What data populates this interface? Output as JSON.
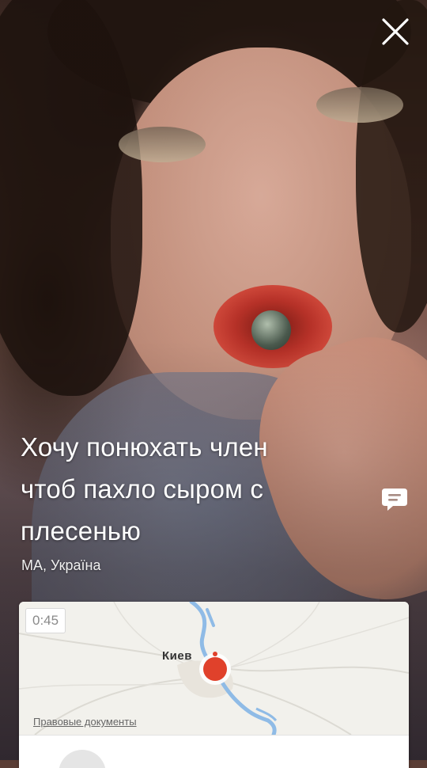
{
  "post": {
    "text_lines": [
      "Хочу понюхать член",
      "чтоб пахло сыром с",
      "плесенью"
    ],
    "location": "МА, Україна"
  },
  "map": {
    "timer": "0:45",
    "city": "Киев",
    "legal_link": "Правовые документы"
  },
  "icons": {
    "close": "close-icon",
    "comment": "chat-bubble-icon",
    "marker": "map-marker-icon"
  },
  "colors": {
    "marker": "#e0412b",
    "text": "#ffffff",
    "river": "#8fbbe6"
  }
}
